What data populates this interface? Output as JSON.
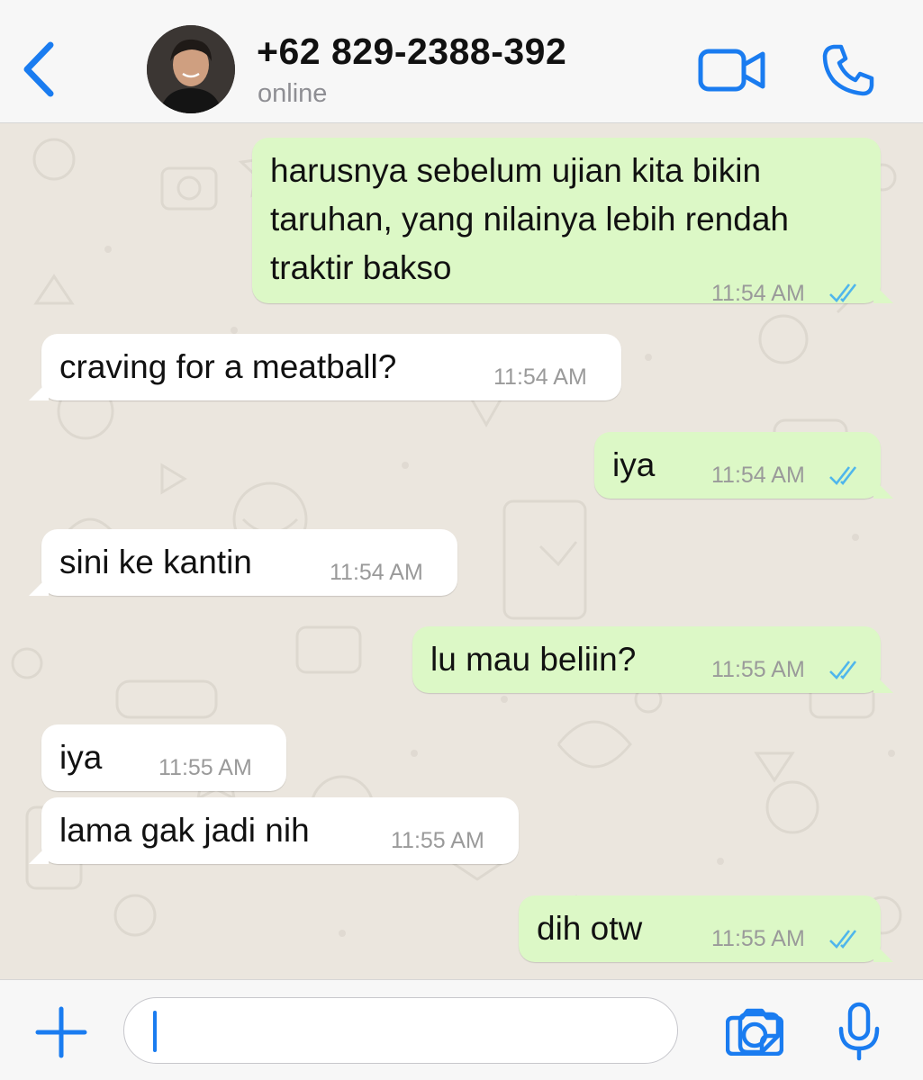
{
  "header": {
    "contact_name": "+62 829-2388-392",
    "status": "online",
    "icons": [
      "back-chevron-icon",
      "video-call-icon",
      "phone-call-icon"
    ]
  },
  "messages": [
    {
      "dir": "out",
      "text": "harusnya sebelum ujian kita bikin\ntaruhan, yang nilainya lebih rendah\ntraktir bakso",
      "time": "11:54 AM",
      "read": true
    },
    {
      "dir": "in",
      "text": "craving for a meatball?",
      "time": "11:54 AM"
    },
    {
      "dir": "out",
      "text": "iya",
      "time": "11:54 AM",
      "read": true
    },
    {
      "dir": "in",
      "text": "sini ke kantin",
      "time": "11:54 AM"
    },
    {
      "dir": "out",
      "text": "lu mau beliin?",
      "time": "11:55 AM",
      "read": true
    },
    {
      "dir": "in",
      "text": "iya",
      "time": "11:55 AM"
    },
    {
      "dir": "in",
      "text": "lama gak jadi nih",
      "time": "11:55 AM"
    },
    {
      "dir": "out",
      "text": "dih otw",
      "time": "11:55 AM",
      "read": true
    }
  ],
  "composer": {
    "icons": [
      "plus-icon",
      "sticker-icon",
      "camera-icon",
      "microphone-icon"
    ],
    "value": ""
  },
  "colors": {
    "accent": "#1a7cf0",
    "outgoing_bubble": "#dcf8c6",
    "incoming_bubble": "#ffffff",
    "read_ticks": "#4fb6ec",
    "chat_background": "#ebe6de"
  }
}
